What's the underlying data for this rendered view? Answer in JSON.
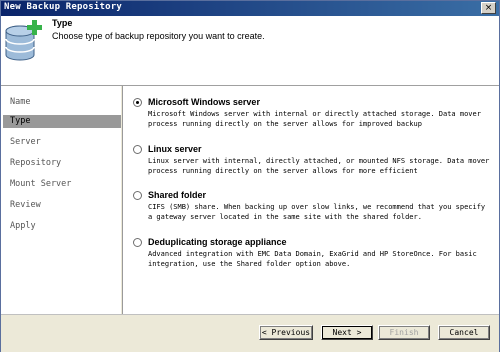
{
  "window": {
    "title": "New Backup Repository",
    "close_glyph": "×"
  },
  "header": {
    "title": "Type",
    "subtitle": "Choose type of backup repository you want to create.",
    "icon": "database-add-icon"
  },
  "sidebar": {
    "items": [
      {
        "label": "Name",
        "active": false
      },
      {
        "label": "Type",
        "active": true
      },
      {
        "label": "Server",
        "active": false
      },
      {
        "label": "Repository",
        "active": false
      },
      {
        "label": "Mount Server",
        "active": false
      },
      {
        "label": "Review",
        "active": false
      },
      {
        "label": "Apply",
        "active": false
      }
    ]
  },
  "options": [
    {
      "label": "Microsoft Windows server",
      "selected": true,
      "desc": "Microsoft Windows server with internal or directly attached storage. Data mover process running directly on the server allows for improved backup"
    },
    {
      "label": "Linux server",
      "selected": false,
      "desc": "Linux server with internal, directly attached, or mounted NFS storage. Data mover process running directly on the server allows for more efficient"
    },
    {
      "label": "Shared folder",
      "selected": false,
      "desc": "CIFS (SMB) share. When backing up over slow links, we recommend that you specify a gateway server located in the same site with the shared folder."
    },
    {
      "label": "Deduplicating storage appliance",
      "selected": false,
      "desc": "Advanced integration with EMC Data Domain, ExaGrid and HP StoreOnce. For basic integration, use the Shared folder option above."
    }
  ],
  "buttons": {
    "previous": "< Previous",
    "next": "Next >",
    "finish": "Finish",
    "cancel": "Cancel"
  }
}
